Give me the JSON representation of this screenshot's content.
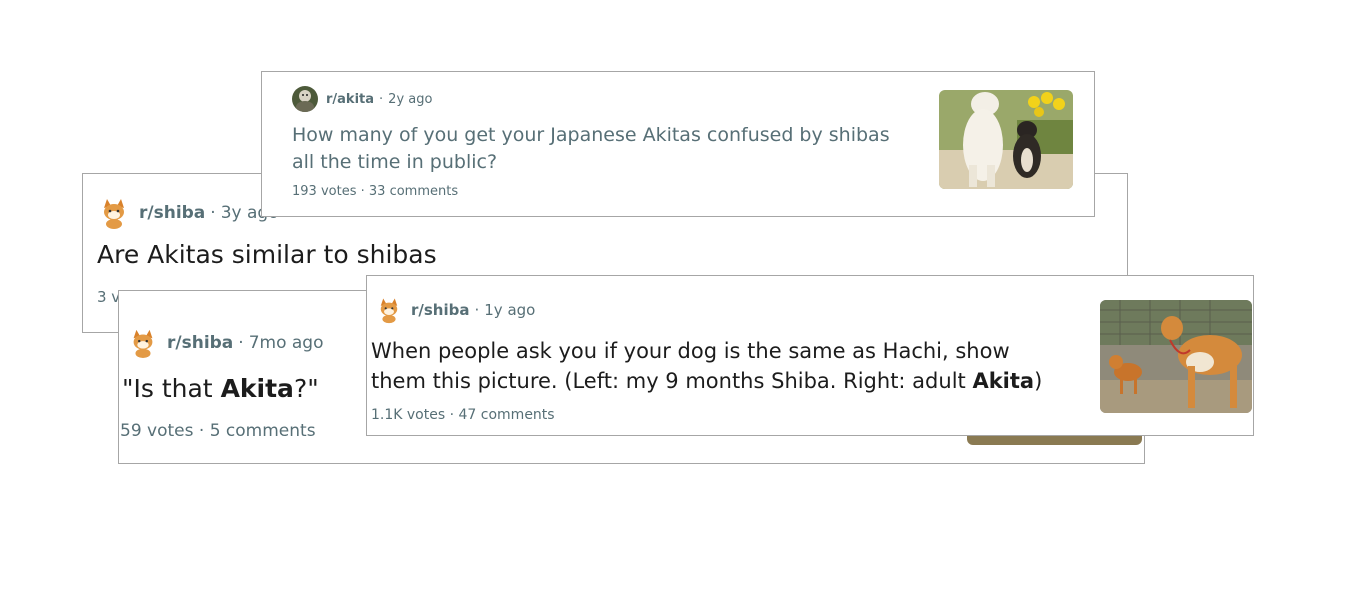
{
  "posts": [
    {
      "id": "cardA",
      "subreddit": "r/shiba",
      "age": "3y ago",
      "title": "Are Akitas similar to shibas",
      "stats": "3 v",
      "avatar_icon": "shiba-avatar-icon"
    },
    {
      "id": "cardB",
      "subreddit": "r/akita",
      "age": "2y ago",
      "title": "How many of you get your Japanese Akitas confused by shibas all the time in public?",
      "votes": "193 votes",
      "comments": "33 comments",
      "avatar_icon": "akita-avatar-icon",
      "thumbnail_icon": "akita-and-shiba-photo"
    },
    {
      "id": "cardC",
      "subreddit": "r/shiba",
      "age": "7mo ago",
      "title_pre": "\"Is that ",
      "title_bold": "Akita",
      "title_post": "?\"",
      "votes": "59 votes",
      "comments": "5 comments",
      "avatar_icon": "shiba-avatar-icon"
    },
    {
      "id": "cardD",
      "subreddit": "r/shiba",
      "age": "1y ago",
      "title_pre": "When people ask you if your dog is the same as Hachi, show them this picture. (Left: my 9 months Shiba. Right: adult ",
      "title_bold": "Akita",
      "title_post": ")",
      "votes": "1.1K votes",
      "comments": "47 comments",
      "avatar_icon": "shiba-avatar-icon",
      "thumbnail_icon": "shiba-and-akita-photo"
    }
  ],
  "separator": "·",
  "colors": {
    "meta": "#576f76",
    "title": "#1c1c1c",
    "border": "#a6a6a6"
  }
}
